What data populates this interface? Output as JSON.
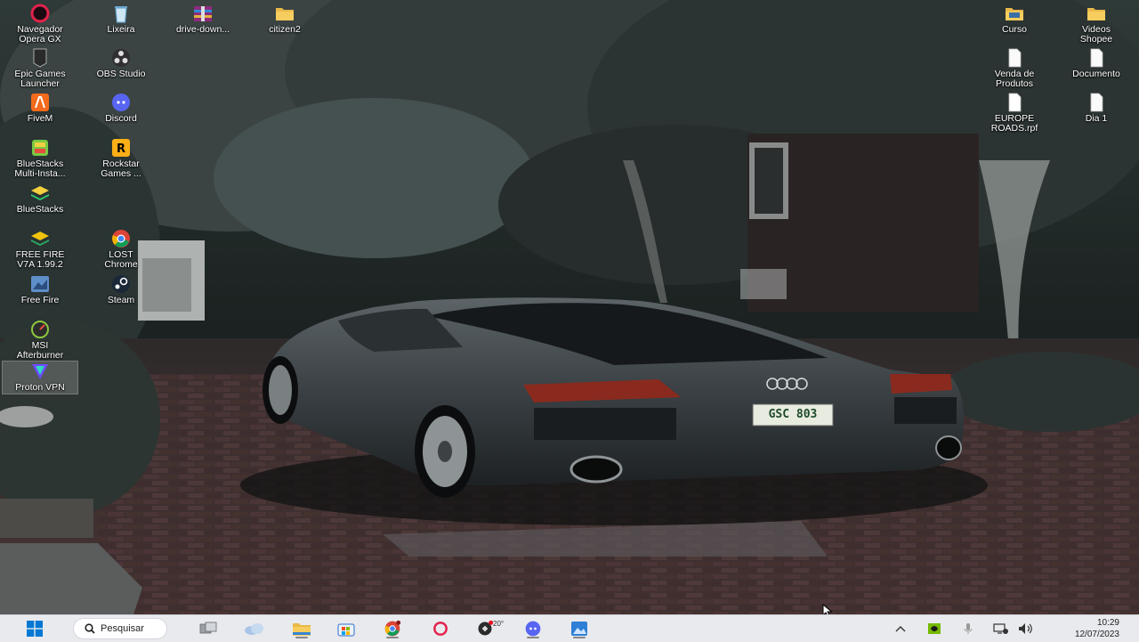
{
  "desktop": {
    "left_icons": [
      {
        "label": "Navegador\nOpera GX",
        "icon": "opera-gx-icon"
      },
      {
        "label": "Lixeira",
        "icon": "recycle-bin-icon"
      },
      {
        "label": "drive-down...",
        "icon": "archive-icon"
      },
      {
        "label": "citizen2",
        "icon": "folder-icon"
      },
      {
        "label": "Epic Games\nLauncher",
        "icon": "epic-games-icon"
      },
      {
        "label": "OBS Studio",
        "icon": "obs-studio-icon"
      },
      {
        "label": "FiveM",
        "icon": "fivem-icon"
      },
      {
        "label": "Discord",
        "icon": "discord-icon"
      },
      {
        "label": "BlueStacks\nMulti-Insta...",
        "icon": "bluestacks-multi-icon"
      },
      {
        "label": "Rockstar\nGames ...",
        "icon": "rockstar-games-icon"
      },
      {
        "label": "BlueStacks",
        "icon": "bluestacks-icon"
      },
      {
        "label": "FREE FIRE\nV7A 1.99.2",
        "icon": "free-fire-icon"
      },
      {
        "label": "LOST\nChrome",
        "icon": "chrome-icon"
      },
      {
        "label": "Free Fire",
        "icon": "free-fire-shortcut-icon"
      },
      {
        "label": "Steam",
        "icon": "steam-icon"
      },
      {
        "label": "MSI\nAfterburner",
        "icon": "msi-afterburner-icon"
      },
      {
        "label": "Proton VPN",
        "icon": "proton-vpn-icon"
      }
    ],
    "right_icons": [
      {
        "label": "Curso",
        "icon": "folder-icon"
      },
      {
        "label": "Videos\nShopee",
        "icon": "folder-icon"
      },
      {
        "label": "Venda de\nProdutos",
        "icon": "document-icon"
      },
      {
        "label": "Documento",
        "icon": "document-icon"
      },
      {
        "label": "EUROPE\nROADS.rpf",
        "icon": "file-icon"
      },
      {
        "label": "Dia 1",
        "icon": "document-icon"
      }
    ],
    "plate_text": "GSC 803"
  },
  "taskbar": {
    "search_label": "Pesquisar",
    "weather_temp": "20°",
    "time": "10:29",
    "date": "12/07/2023",
    "accent": "#0078d4"
  }
}
